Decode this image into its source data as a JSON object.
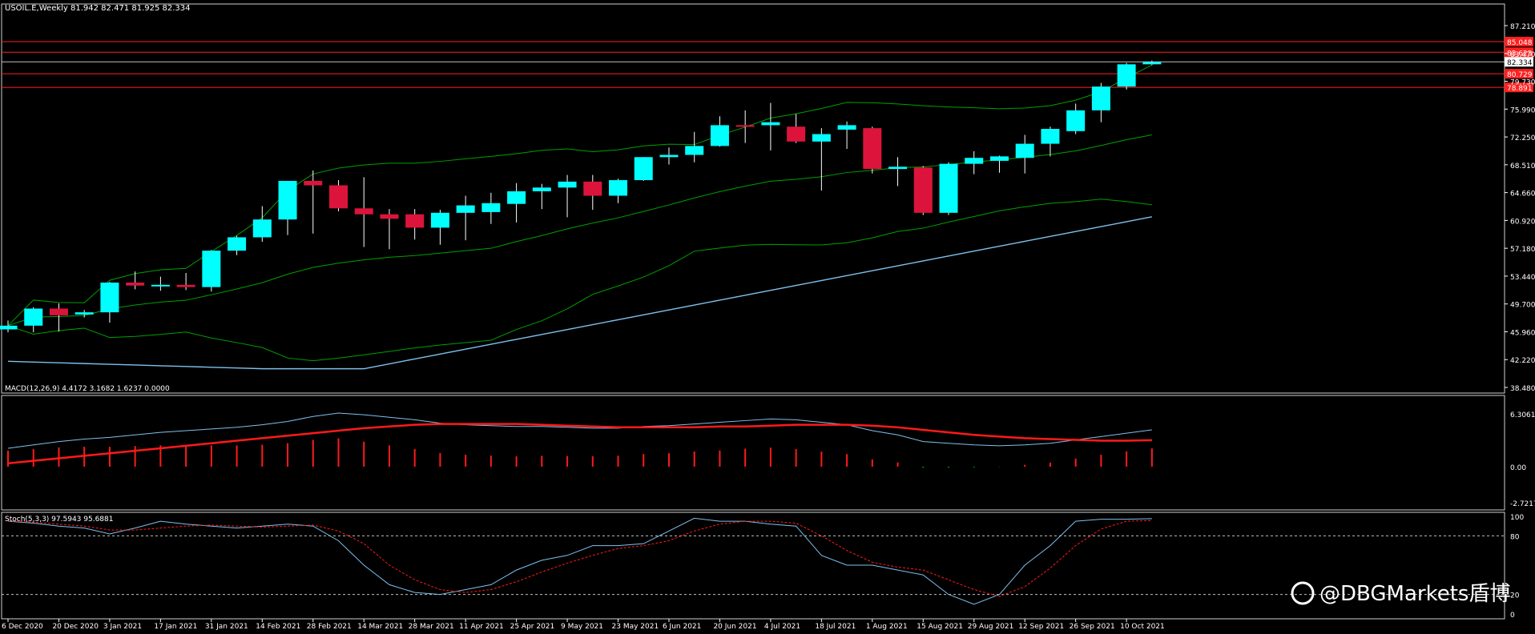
{
  "main": {
    "symbol_title": "USOIL.E,Weekly  81.942 82.471 81.925 82.334",
    "y_ticks": [
      "87.210",
      "83.470",
      "79.730",
      "75.990",
      "72.250",
      "68.510",
      "64.660",
      "60.920",
      "57.180",
      "53.440",
      "49.700",
      "45.960",
      "42.220",
      "38.480"
    ],
    "current_price_label": "82.334",
    "hlines": [
      {
        "label": "85.048",
        "value": 85.048,
        "color": "#ff2020"
      },
      {
        "label": "83.623",
        "value": 83.623,
        "color": "#ff2020"
      },
      {
        "label": "80.729",
        "value": 80.729,
        "color": "#ff2020"
      },
      {
        "label": "78.891",
        "value": 78.891,
        "color": "#ff2020"
      }
    ],
    "current_line": {
      "value": 82.334,
      "color": "#c0c0c0"
    }
  },
  "macd": {
    "title": "MACD(12,26,9) 4.4172 3.1682 1.6237 0.0000",
    "y_ticks": [
      "6.3061",
      "0.00",
      "-2.7217"
    ]
  },
  "stoch": {
    "title": "Stoch(5,3,3) 97.5943 95.6881",
    "y_ticks": [
      "100",
      "80",
      "20",
      "0"
    ]
  },
  "x_labels": [
    "6 Dec 2020",
    "20 Dec 2020",
    "3 Jan 2021",
    "17 Jan 2021",
    "31 Jan 2021",
    "14 Feb 2021",
    "28 Feb 2021",
    "14 Mar 2021",
    "28 Mar 2021",
    "11 Apr 2021",
    "25 Apr 2021",
    "9 May 2021",
    "23 May 2021",
    "6 Jun 2021",
    "20 Jun 2021",
    "4 Jul 2021",
    "18 Jul 2021",
    "1 Aug 2021",
    "15 Aug 2021",
    "29 Aug 2021",
    "12 Sep 2021",
    "26 Sep 2021",
    "10 Oct 2021"
  ],
  "watermark": "@DBGMarkets盾博",
  "colors": {
    "bull": "#00ffff",
    "bear": "#dc143c",
    "macd_line": "#7ec0ee",
    "signal": "#ff1a1a",
    "hist_pos": "#ff1a1a",
    "hist_neg": "#00a000",
    "bb": "#00a000",
    "ma": "#7ec0ee",
    "stoch_k": "#7ec0ee",
    "stoch_d": "#ff1a1a"
  },
  "chart_data": {
    "type": "candlestick",
    "weeks": [
      "6 Dec 2020",
      "13 Dec 2020",
      "20 Dec 2020",
      "27 Dec 2020",
      "3 Jan 2021",
      "10 Jan 2021",
      "17 Jan 2021",
      "24 Jan 2021",
      "31 Jan 2021",
      "7 Feb 2021",
      "14 Feb 2021",
      "21 Feb 2021",
      "28 Feb 2021",
      "7 Mar 2021",
      "14 Mar 2021",
      "21 Mar 2021",
      "28 Mar 2021",
      "4 Apr 2021",
      "11 Apr 2021",
      "18 Apr 2021",
      "25 Apr 2021",
      "2 May 2021",
      "9 May 2021",
      "16 May 2021",
      "23 May 2021",
      "30 May 2021",
      "6 Jun 2021",
      "13 Jun 2021",
      "20 Jun 2021",
      "27 Jun 2021",
      "4 Jul 2021",
      "11 Jul 2021",
      "18 Jul 2021",
      "25 Jul 2021",
      "1 Aug 2021",
      "8 Aug 2021",
      "15 Aug 2021",
      "22 Aug 2021",
      "29 Aug 2021",
      "5 Sep 2021",
      "12 Sep 2021",
      "19 Sep 2021",
      "26 Sep 2021",
      "3 Oct 2021",
      "10 Oct 2021",
      "17 Oct 2021"
    ],
    "open": [
      46.3,
      46.8,
      49.1,
      48.3,
      48.6,
      52.6,
      52.1,
      52.3,
      52.0,
      56.9,
      58.7,
      61.1,
      66.3,
      65.7,
      62.6,
      61.8,
      61.8,
      60.0,
      62.0,
      62.1,
      63.2,
      64.9,
      65.4,
      66.2,
      64.3,
      66.4,
      69.5,
      69.8,
      71.0,
      73.8,
      73.8,
      73.6,
      71.6,
      73.2,
      73.4,
      67.9,
      68.1,
      62.0,
      68.6,
      69.0,
      69.4,
      71.3,
      73.0,
      75.8,
      79.0,
      82.0
    ],
    "high": [
      47.5,
      49.3,
      49.8,
      48.9,
      52.7,
      54.1,
      53.4,
      53.9,
      57.0,
      58.9,
      62.9,
      63.5,
      67.7,
      66.4,
      66.8,
      62.5,
      62.5,
      62.4,
      64.3,
      64.7,
      66.0,
      65.9,
      67.1,
      67.1,
      66.6,
      69.5,
      70.8,
      72.9,
      75.0,
      75.8,
      76.8,
      75.3,
      73.4,
      74.3,
      73.6,
      69.5,
      68.3,
      68.8,
      70.3,
      69.7,
      72.5,
      73.6,
      76.7,
      79.5,
      82.2,
      82.5
    ],
    "low": [
      45.9,
      45.9,
      46.0,
      47.9,
      47.2,
      51.7,
      51.5,
      51.6,
      51.4,
      56.3,
      58.1,
      59.0,
      59.2,
      62.2,
      57.4,
      57.1,
      58.4,
      57.7,
      58.3,
      60.5,
      60.7,
      62.5,
      61.4,
      62.4,
      63.3,
      66.3,
      68.5,
      68.8,
      70.9,
      71.4,
      70.4,
      71.4,
      65.0,
      70.6,
      67.3,
      65.6,
      61.7,
      61.7,
      67.2,
      67.4,
      67.3,
      69.6,
      72.6,
      74.2,
      78.6,
      81.9
    ],
    "close": [
      46.8,
      49.1,
      48.2,
      48.6,
      52.6,
      52.2,
      52.3,
      52.0,
      56.9,
      58.7,
      61.1,
      66.3,
      65.7,
      62.6,
      61.8,
      61.2,
      60.0,
      62.0,
      63.0,
      63.3,
      64.9,
      65.4,
      66.2,
      64.3,
      66.4,
      69.5,
      69.8,
      71.0,
      73.8,
      73.6,
      74.2,
      71.6,
      72.6,
      73.8,
      67.9,
      68.2,
      62.0,
      68.6,
      69.4,
      69.6,
      71.3,
      73.3,
      75.8,
      79.0,
      82.0,
      82.3
    ],
    "ylim": [
      38.48,
      87.21
    ]
  }
}
